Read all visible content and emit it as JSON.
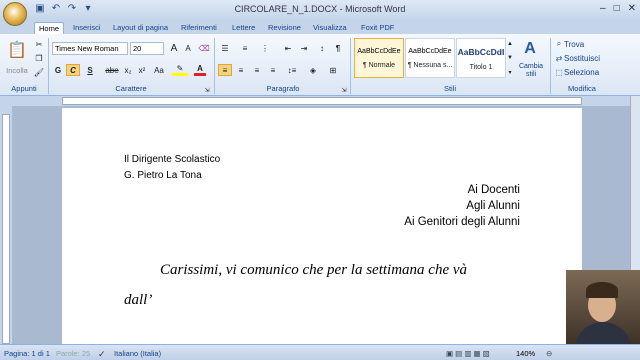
{
  "window": {
    "title": "CIRCOLARE_N_1.DOCX - Microsoft Word"
  },
  "tabs": [
    "Home",
    "Inserisci",
    "Layout di pagina",
    "Riferimenti",
    "Lettere",
    "Revisione",
    "Visualizza",
    "Foxit PDF"
  ],
  "ribbon": {
    "clipboard": {
      "label": "Appunti",
      "paste_label": "Incolla"
    },
    "font": {
      "label": "Carattere",
      "font_name": "Times New Roman",
      "font_size": "20",
      "bold": "G",
      "italic": "C",
      "underline": "S",
      "strike": "abe",
      "subscript": "x₂",
      "superscript": "x²",
      "case": "Aa"
    },
    "paragraph": {
      "label": "Paragrafo"
    },
    "styles": {
      "label": "Stili",
      "items": [
        {
          "sample": "AaBbCcDdEe",
          "name": "¶ Normale"
        },
        {
          "sample": "AaBbCcDdEe",
          "name": "¶ Nessuna s..."
        },
        {
          "sample": "AaBbCcDdI",
          "name": "Titolo 1"
        }
      ],
      "change_styles": "Cambia stili"
    },
    "editing": {
      "label": "Modifica",
      "find": "Trova",
      "replace": "Sostituisci",
      "select": "Seleziona"
    }
  },
  "document": {
    "sender_line1": "Il Dirigente Scolastico",
    "sender_line2": "G. Pietro La Tona",
    "recipient1": "Ai Docenti",
    "recipient2": "Agli Alunni",
    "recipient3": "Ai Genitori degli Alunni",
    "body_line1": "Carissimi, vi comunico che per la settimana che và",
    "body_line2": "dall’"
  },
  "status": {
    "page": "Pagina: 1 di 1",
    "words": "Parole: 25",
    "language": "Italiano (Italia)",
    "zoom": "140%"
  }
}
